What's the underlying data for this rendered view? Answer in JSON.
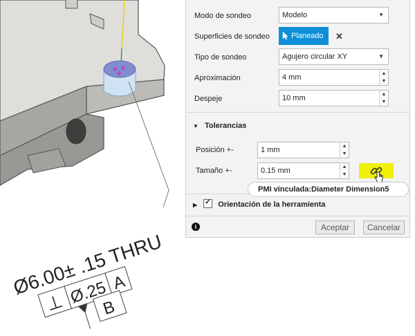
{
  "panel": {
    "rows": {
      "modo_label": "Modo de sondeo",
      "modo_value": "Modelo",
      "superficies_label": "Superficies de sondeo",
      "superficies_button": "Planeado",
      "tipo_label": "Tipo de sondeo",
      "tipo_value": "Agujero circular XY",
      "aproximacion_label": "Aproximación",
      "aproximacion_value": "4 mm",
      "despeje_label": "Despeje",
      "despeje_value": "10 mm"
    },
    "tolerancias": {
      "title": "Tolerancias",
      "posicion_label": "Posición +-",
      "posicion_value": "1 mm",
      "tamano_label": "Tamaño +-",
      "tamano_value": "0.15 mm"
    },
    "tooltip": "PMI vinculada:Diameter Dimension5",
    "orientacion_label": "Orientación de la herramienta",
    "footer": {
      "accept": "Aceptar",
      "cancel": "Cancelar"
    },
    "icons": {
      "dropdown": "▼",
      "spin_up": "▲",
      "spin_down": "▼",
      "close": "✕",
      "expanded": "▼",
      "collapsed": "▶",
      "info": "i",
      "checkbox": "✓"
    }
  },
  "model": {
    "dimension_text": "Ø6.00± .15 THRU",
    "perp_symbol": "⊥",
    "tolerance_text": "Ø.25",
    "datum_ref": "A",
    "datum_b": "B"
  }
}
